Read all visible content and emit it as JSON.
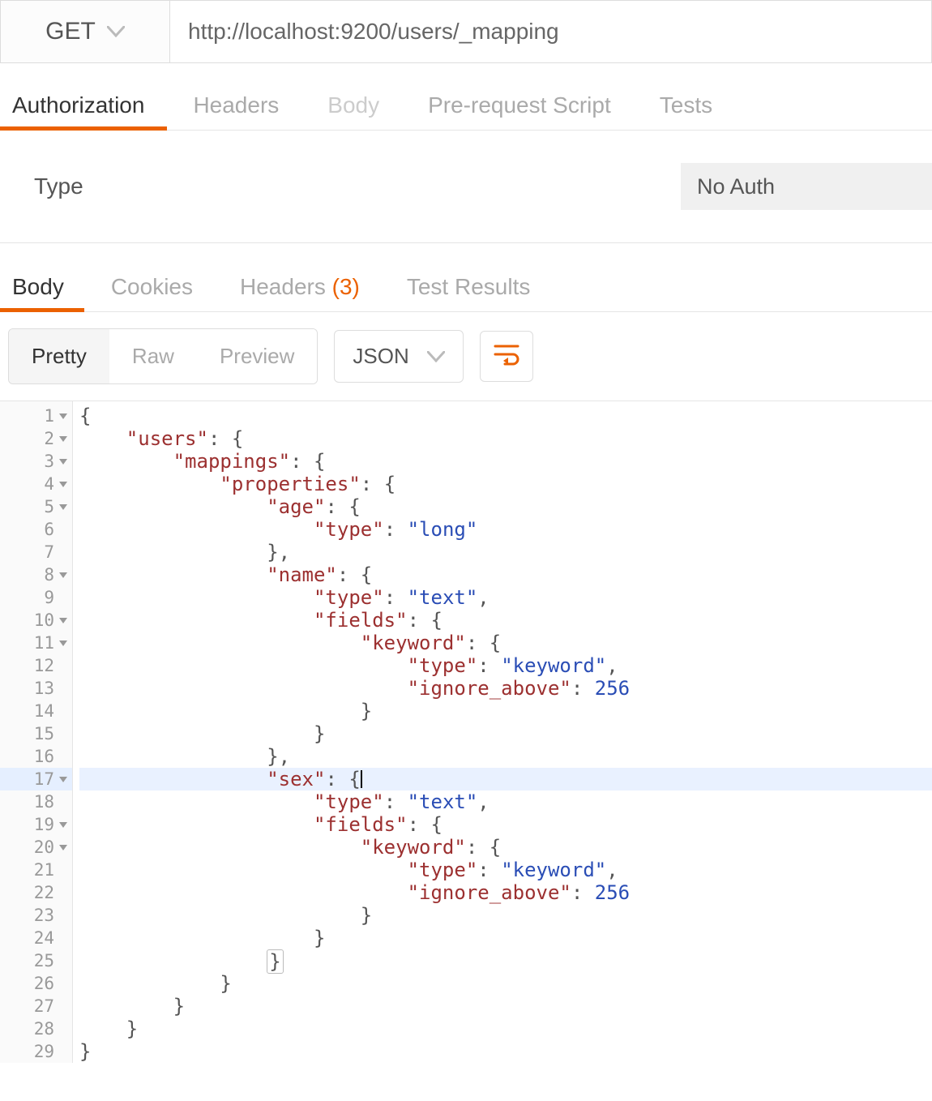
{
  "request": {
    "method": "GET",
    "url": "http://localhost:9200/users/_mapping"
  },
  "request_tabs": {
    "authorization": "Authorization",
    "headers": "Headers",
    "body": "Body",
    "prerequest": "Pre-request Script",
    "tests": "Tests"
  },
  "auth": {
    "type_label": "Type",
    "value": "No Auth"
  },
  "response_tabs": {
    "body": "Body",
    "cookies": "Cookies",
    "headers_label": "Headers",
    "headers_count": "(3)",
    "test_results": "Test Results"
  },
  "view_modes": {
    "pretty": "Pretty",
    "raw": "Raw",
    "preview": "Preview"
  },
  "format_select": "JSON",
  "code_lines": [
    "{",
    "    \"users\": {",
    "        \"mappings\": {",
    "            \"properties\": {",
    "                \"age\": {",
    "                    \"type\": \"long\"",
    "                },",
    "                \"name\": {",
    "                    \"type\": \"text\",",
    "                    \"fields\": {",
    "                        \"keyword\": {",
    "                            \"type\": \"keyword\",",
    "                            \"ignore_above\": 256",
    "                        }",
    "                    }",
    "                },",
    "                \"sex\": {",
    "                    \"type\": \"text\",",
    "                    \"fields\": {",
    "                        \"keyword\": {",
    "                            \"type\": \"keyword\",",
    "                            \"ignore_above\": 256",
    "                        }",
    "                    }",
    "                }",
    "            }",
    "        }",
    "    }",
    "}"
  ],
  "foldable_lines": [
    1,
    2,
    3,
    4,
    5,
    8,
    10,
    11,
    17,
    19,
    20
  ],
  "highlighted_line": 17
}
